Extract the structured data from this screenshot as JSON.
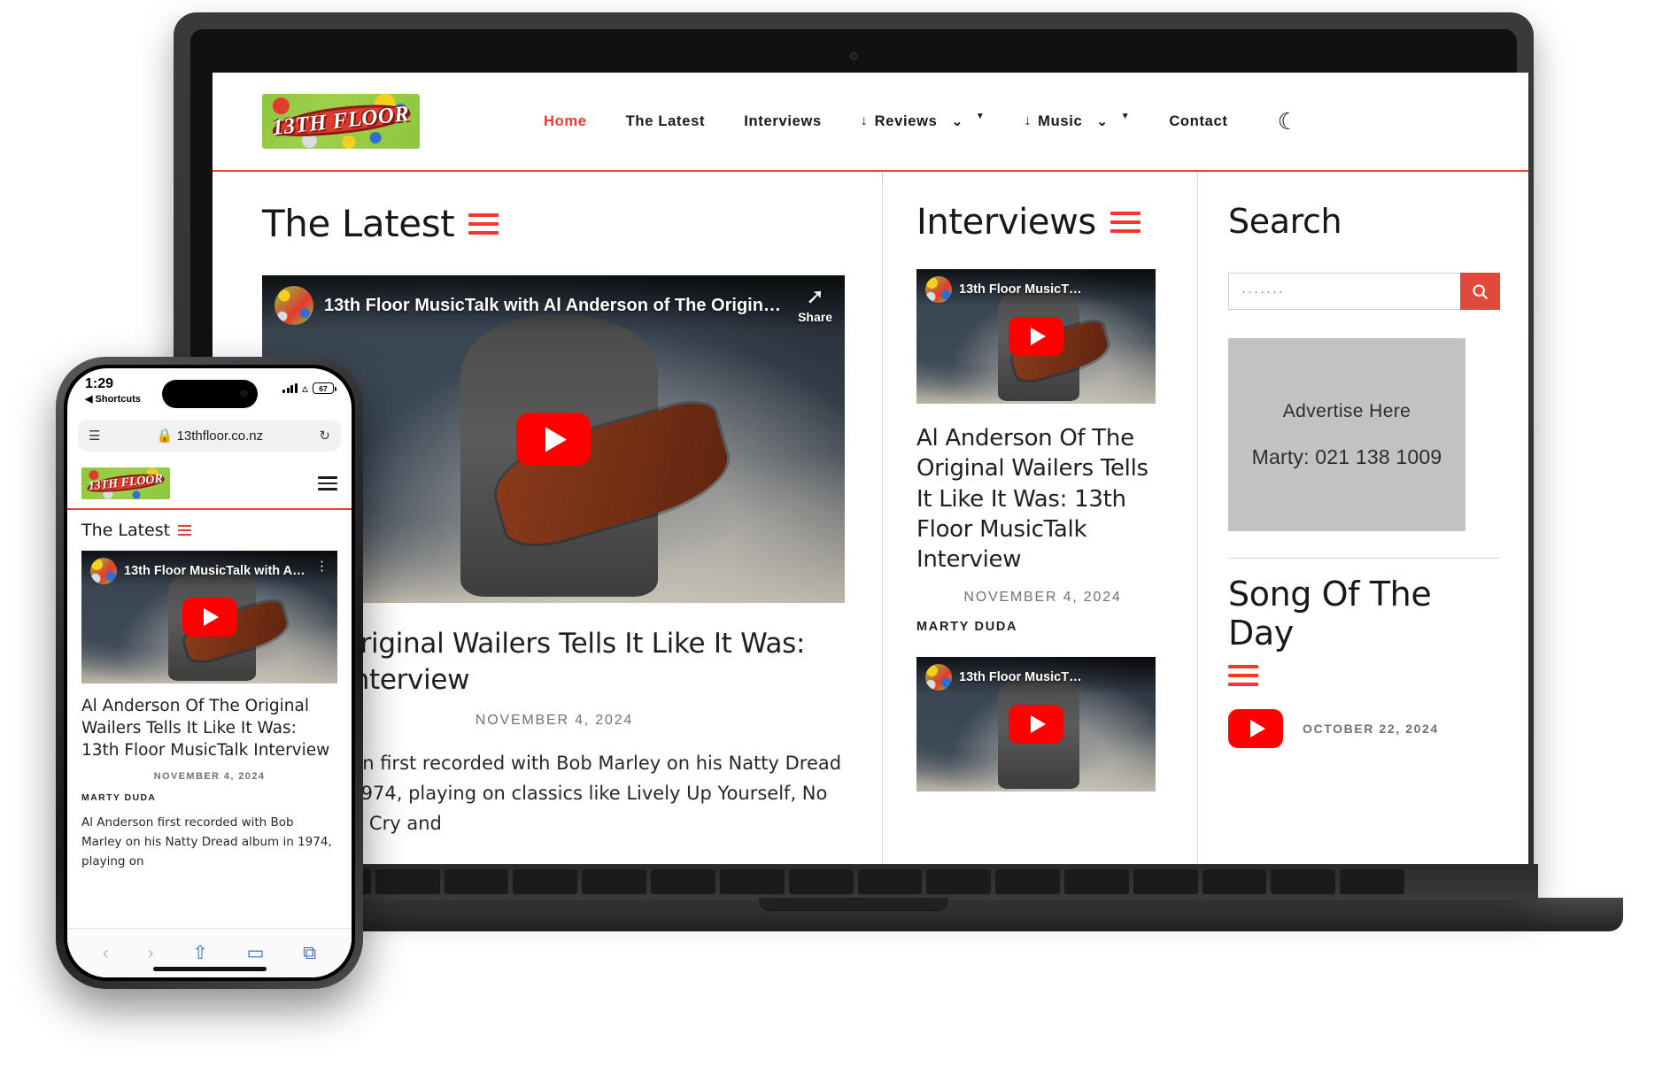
{
  "site": {
    "logo_text": "13TH FLOOR",
    "nav": [
      {
        "label": "Home",
        "active": true,
        "arrow": "",
        "chevron": ""
      },
      {
        "label": "The Latest",
        "active": false,
        "arrow": "",
        "chevron": ""
      },
      {
        "label": "Interviews",
        "active": false,
        "arrow": "",
        "chevron": ""
      },
      {
        "label": "Reviews",
        "active": false,
        "arrow": "↓",
        "chevron": "⌄"
      },
      {
        "label": "Music",
        "active": false,
        "arrow": "↓",
        "chevron": "⌄"
      },
      {
        "label": "Contact",
        "active": false,
        "arrow": "",
        "chevron": ""
      }
    ],
    "dark_mode_icon": "☾",
    "accent_color": "#f4372a",
    "header_rule_color": "#e8432e"
  },
  "latest": {
    "heading": "The Latest",
    "video": {
      "title": "13th Floor MusicTalk with Al Anderson of The Original…",
      "share_label": "Share",
      "share_icon": "➚",
      "play_icon": "play-button"
    },
    "article": {
      "title": "Al Anderson Of The Original Wailers Tells It Like It Was: 13th Floor MusicTalk Interview",
      "title_visible_fragment": "f The Original Wailers Tells It Like It Was: icTalk Interview",
      "date": "NOVEMBER 4, 2024",
      "body": "Al Anderson first recorded with Bob Marley on his Natty Dread album in 1974, playing on classics like Lively Up Yourself, No Woman No Cry and"
    }
  },
  "interviews": {
    "heading": "Interviews",
    "video": {
      "title": "13th Floor MusicT…",
      "play_icon": "play-button"
    },
    "article": {
      "title": "Al Anderson Of The Original Wailers Tells It Like It Was: 13th Floor MusicTalk Interview",
      "date": "NOVEMBER 4, 2024",
      "author": "MARTY DUDA"
    },
    "video2": {
      "title": "13th Floor MusicT…",
      "play_icon": "play-button"
    }
  },
  "sidebar": {
    "search": {
      "heading": "Search",
      "placeholder": "·······",
      "value": "",
      "button_icon": "search-icon",
      "button_color": "#e04a3c"
    },
    "ad": {
      "line1": "Advertise Here",
      "line2": "Marty: 021 138 1009",
      "bg_color": "#c2c2c2"
    },
    "song_of_the_day": {
      "heading": "Song Of The Day",
      "date": "OCTOBER 22, 2024",
      "play_icon": "play-button"
    }
  },
  "phone": {
    "status": {
      "time": "1:29",
      "back_label": "◀ Shortcuts",
      "battery": "67"
    },
    "browser": {
      "url": "13thfloor.co.nz",
      "lock_icon": "ὑ2",
      "reader_icon": "☰",
      "reload_icon": "↻"
    },
    "header": {
      "logo_text": "13TH FLOOR",
      "menu_icon": "hamburger-icon"
    },
    "section": {
      "heading": "The Latest"
    },
    "video": {
      "title": "13th Floor MusicTalk with Al A…",
      "menu_icon": "⋮"
    },
    "article": {
      "title": "Al Anderson Of The Original Wailers Tells It Like It Was: 13th Floor MusicTalk Interview",
      "date": "NOVEMBER 4, 2024",
      "author": "MARTY DUDA",
      "body": "Al Anderson first recorded with Bob Marley on his Natty Dread album in 1974, playing on"
    },
    "toolbar": {
      "back": "‹",
      "forward": "›",
      "share": "⇧",
      "bookmarks": "▭",
      "tabs": "⧉"
    }
  }
}
